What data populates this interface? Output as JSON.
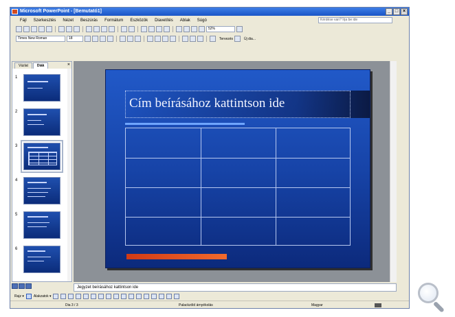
{
  "window": {
    "title": "Microsoft PowerPoint - [Bemutató1]",
    "controls": [
      "_",
      "□",
      "×"
    ]
  },
  "menu": {
    "items": [
      "Fájl",
      "Szerkesztés",
      "Nézet",
      "Beszúrás",
      "Formátum",
      "Eszközök",
      "Diavetítés",
      "Ablak",
      "Súgó"
    ],
    "help_placeholder": "Kérdése van? Írja be ide"
  },
  "toolbar": {
    "zoom": "52%",
    "font_name": "Times New Roman",
    "font_size": "18",
    "design_label": "Tervezés",
    "new_slide_label": "Új dia..."
  },
  "outline_panel": {
    "tabs": [
      "Vázlat",
      "Diák"
    ],
    "close": "×",
    "slides": [
      {
        "number": "1"
      },
      {
        "number": "2"
      },
      {
        "number": "3"
      },
      {
        "number": "4"
      },
      {
        "number": "5"
      },
      {
        "number": "6"
      }
    ]
  },
  "slide": {
    "title_placeholder": "Cím beírásához kattintson ide"
  },
  "notes": {
    "placeholder": "Jegyzet beírásához kattintson ide"
  },
  "drawing": {
    "draw_label": "Rajz ▾",
    "autoshapes_label": "Alakzatok ▾"
  },
  "status": {
    "slide_counter": "Dia 3 / 3",
    "design": "Palackzöld árnyékolás",
    "language": "Magyar"
  },
  "colors": {
    "slide_background": "#1744a8",
    "title_bar": "#1a55c6",
    "accent_red": "#d13a15"
  }
}
